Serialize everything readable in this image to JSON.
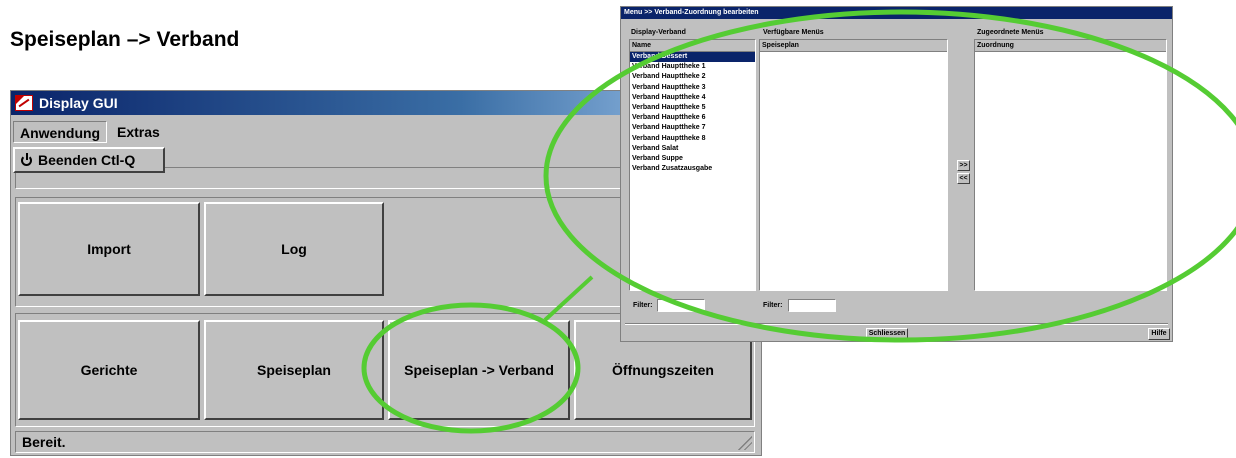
{
  "page_heading": "Speiseplan –> Verband",
  "gui": {
    "title": "Display GUI",
    "menu": {
      "anwendung": "Anwendung",
      "extras": "Extras"
    },
    "dropdown_item": "Beenden Ctl-Q",
    "buttons": {
      "import": "Import",
      "log": "Log",
      "gerichte": "Gerichte",
      "speiseplan": "Speiseplan",
      "speiseplan_verband": "Speiseplan -> Verband",
      "oeffnungszeiten": "Öffnungszeiten"
    },
    "status": "Bereit."
  },
  "dialog": {
    "title": "Menu >> Verband-Zuordnung bearbeiten",
    "left": {
      "label": "Display-Verband",
      "header": "Name",
      "items": [
        "Verband Dessert",
        "Verband Haupttheke 1",
        "Verband Haupttheke 2",
        "Verband Haupttheke 3",
        "Verband Haupttheke 4",
        "Verband Haupttheke 5",
        "Verband Haupttheke 6",
        "Verband Haupttheke 7",
        "Verband Haupttheke 8",
        "Verband Salat",
        "Verband Suppe",
        "Verband Zusatzausgabe"
      ],
      "selected_index": 0,
      "filter_label": "Filter:"
    },
    "middle": {
      "label": "Verfügbare Menüs",
      "header": "Speiseplan",
      "filter_label": "Filter:"
    },
    "right": {
      "label": "Zugeordnete Menüs",
      "header": "Zuordnung"
    },
    "add_button": ">>",
    "remove_button": "<<",
    "close_button": "Schliessen",
    "help_button": "Hilfe"
  },
  "highlight_color": "#55cc33",
  "selection_color": "#0a246a"
}
